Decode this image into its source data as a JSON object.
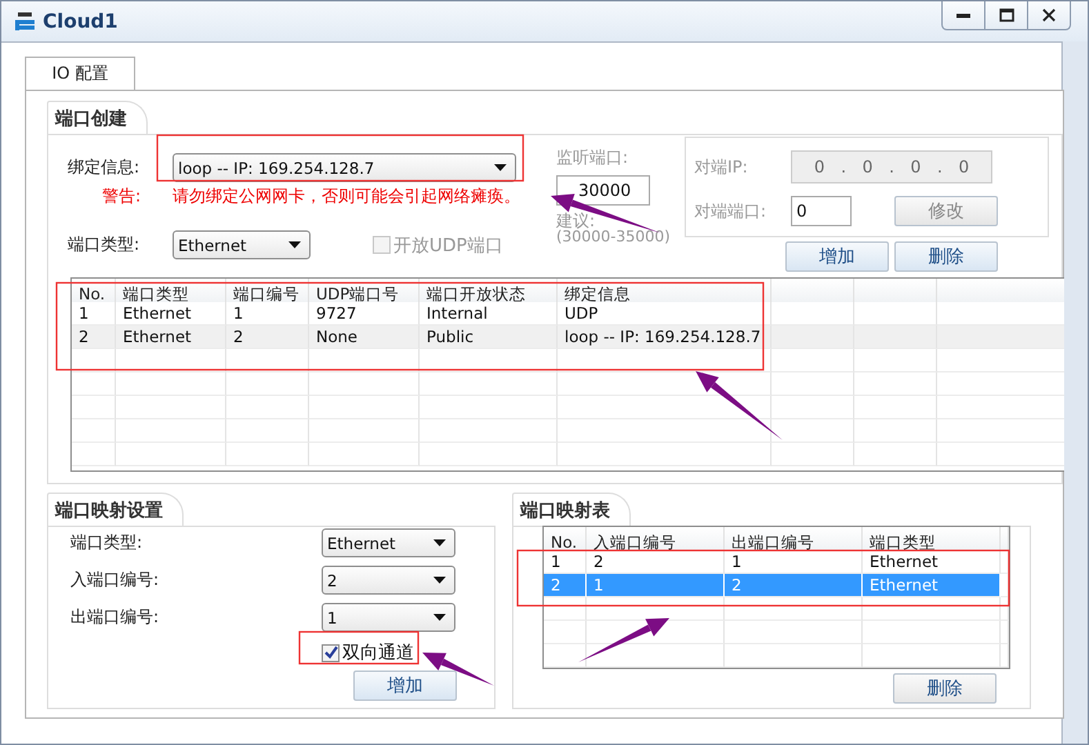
{
  "window": {
    "title": "Cloud1"
  },
  "tabs": [
    {
      "label": "IO 配置",
      "selected": true
    }
  ],
  "port_creation": {
    "title": "端口创建",
    "binding": {
      "label": "绑定信息:",
      "value": "loop -- IP: 169.254.128.7"
    },
    "warning": {
      "label": "警告:",
      "text": "请勿绑定公网网卡，否则可能会引起网络瘫痪。"
    },
    "port_type": {
      "label": "端口类型:",
      "value": "Ethernet"
    },
    "open_udp": {
      "label": "开放UDP端口",
      "checked": false,
      "disabled": true
    },
    "listen_port": {
      "label": "监听端口:",
      "value": "30000",
      "hint": "建议:",
      "range": "(30000-35000)",
      "disabled": true
    },
    "peer": {
      "disabled": true,
      "ip_label": "对端IP:",
      "ip_octets": [
        "0",
        "0",
        "0",
        "0"
      ],
      "ip_separator": ".",
      "port_label": "对端端口:",
      "port_value": "0",
      "modify_button": "修改"
    },
    "add_button": "增加",
    "delete_button": "删除"
  },
  "port_table": {
    "columns": [
      "No.",
      "端口类型",
      "端口编号",
      "UDP端口号",
      "端口开放状态",
      "绑定信息"
    ],
    "rows": [
      [
        "1",
        "Ethernet",
        "1",
        "9727",
        "Internal",
        "UDP"
      ],
      [
        "2",
        "Ethernet",
        "2",
        "None",
        "Public",
        "loop -- IP: 169.254.128.7"
      ]
    ]
  },
  "mapping_settings": {
    "title": "端口映射设置",
    "fields": [
      {
        "label": "端口类型:",
        "value": "Ethernet"
      },
      {
        "label": "入端口编号:",
        "value": "2"
      },
      {
        "label": "出端口编号:",
        "value": "1"
      }
    ],
    "bidirectional": {
      "label": "双向通道",
      "checked": true
    },
    "add_button": "增加"
  },
  "mapping_table": {
    "title": "端口映射表",
    "columns": [
      "No.",
      "入端口编号",
      "出端口编号",
      "端口类型"
    ],
    "rows": [
      {
        "cells": [
          "1",
          "2",
          "1",
          "Ethernet"
        ],
        "selected": false
      },
      {
        "cells": [
          "2",
          "1",
          "2",
          "Ethernet"
        ],
        "selected": true
      }
    ],
    "delete_button": "删除"
  }
}
